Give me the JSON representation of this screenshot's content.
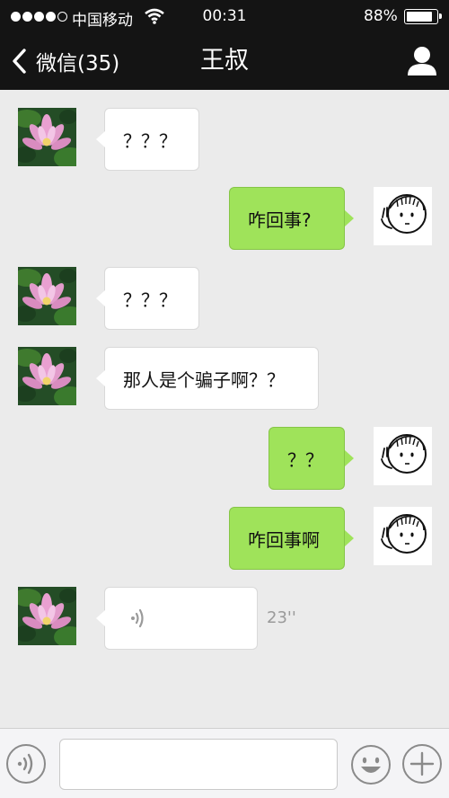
{
  "status_bar": {
    "carrier": "中国移动",
    "time": "00:31",
    "battery_percent": "88%",
    "signal_dots_filled": 4,
    "signal_dots_total": 5,
    "battery_level": 0.88
  },
  "nav": {
    "back_label": "微信(35)",
    "title": "王叔",
    "back_icon": "chevron-left-icon",
    "profile_icon": "person-icon"
  },
  "messages": [
    {
      "side": "left",
      "type": "text",
      "text": "？？？"
    },
    {
      "side": "right",
      "type": "text",
      "text": "咋回事?"
    },
    {
      "side": "left",
      "type": "text",
      "text": "？？？"
    },
    {
      "side": "left",
      "type": "text",
      "text": "那人是个骗子啊？？"
    },
    {
      "side": "right",
      "type": "text",
      "text": "？？"
    },
    {
      "side": "right",
      "type": "text",
      "text": "咋回事啊"
    },
    {
      "side": "left",
      "type": "voice",
      "duration": "23''"
    }
  ],
  "input_bar": {
    "voice_icon": "voice-icon",
    "emoji_icon": "smiley-icon",
    "plus_icon": "plus-icon",
    "text_value": ""
  },
  "colors": {
    "header_bg": "#141414",
    "chat_bg": "#ebebeb",
    "sent_bubble": "#9fe35a",
    "received_bubble": "#ffffff"
  }
}
